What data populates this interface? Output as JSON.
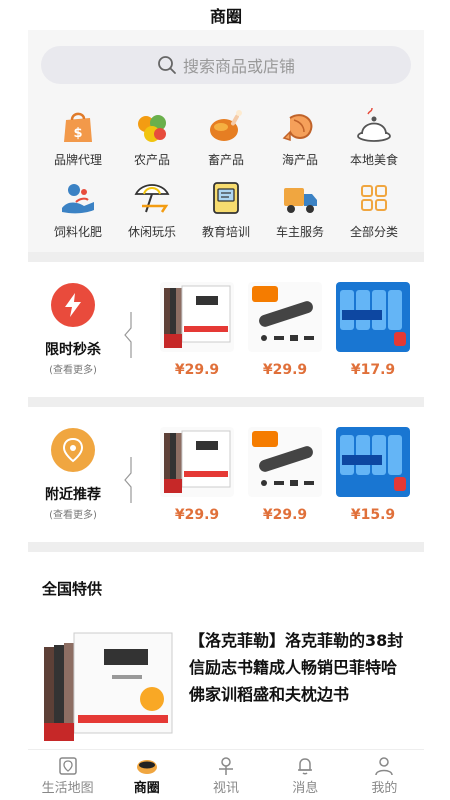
{
  "header": {
    "title": "商圈"
  },
  "search": {
    "placeholder": "搜索商品或店铺"
  },
  "categories": [
    {
      "label": "品牌代理",
      "icon": "shopping-bag-icon"
    },
    {
      "label": "农产品",
      "icon": "fruit-icon"
    },
    {
      "label": "畜产品",
      "icon": "chicken-icon"
    },
    {
      "label": "海产品",
      "icon": "shrimp-icon"
    },
    {
      "label": "本地美食",
      "icon": "dish-icon"
    },
    {
      "label": "饲料化肥",
      "icon": "fertilizer-icon"
    },
    {
      "label": "休闲玩乐",
      "icon": "beach-icon"
    },
    {
      "label": "教育培训",
      "icon": "book-icon"
    },
    {
      "label": "车主服务",
      "icon": "truck-icon"
    },
    {
      "label": "全部分类",
      "icon": "grid-icon"
    }
  ],
  "flash_sale": {
    "title": "限时秒杀",
    "subtitle": "(查看更多)",
    "products": [
      {
        "price": "¥29.9"
      },
      {
        "price": "¥29.9"
      },
      {
        "price": "¥17.9"
      }
    ]
  },
  "nearby": {
    "title": "附近推荐",
    "subtitle": "(查看更多)",
    "products": [
      {
        "price": "¥29.9"
      },
      {
        "price": "¥29.9"
      },
      {
        "price": "¥15.9"
      }
    ]
  },
  "national": {
    "title": "全国特供",
    "item_title": "【洛克菲勒】洛克菲勒的38封信励志书籍成人畅销巴菲特哈佛家训稻盛和夫枕边书"
  },
  "tabbar": [
    {
      "label": "生活地图",
      "icon": "map-icon"
    },
    {
      "label": "商圈",
      "icon": "shop-icon",
      "active": true
    },
    {
      "label": "视讯",
      "icon": "video-icon"
    },
    {
      "label": "消息",
      "icon": "bell-icon"
    },
    {
      "label": "我的",
      "icon": "user-icon"
    }
  ],
  "colors": {
    "accent": "#e94b3c",
    "price": "#e0703a",
    "location": "#f0a640"
  }
}
